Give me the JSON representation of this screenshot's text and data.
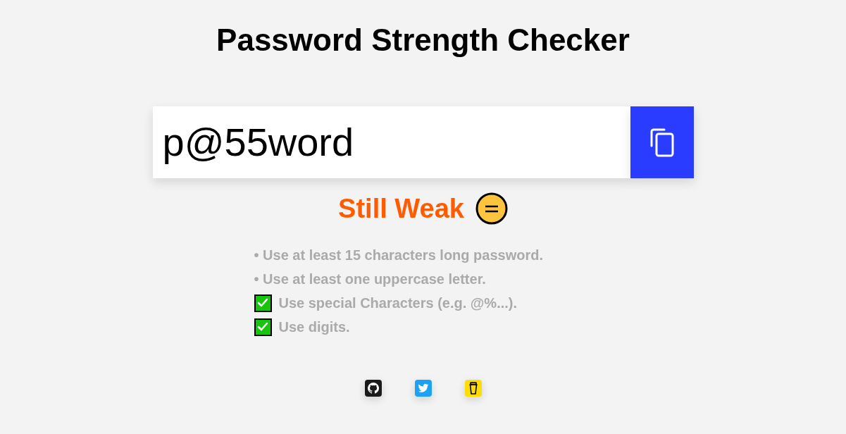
{
  "title": "Password Strength Checker",
  "password": {
    "value": "p@55word"
  },
  "strength": {
    "label": "Still Weak",
    "color": "#ff5b00"
  },
  "rules": {
    "bullet": "•",
    "items": [
      {
        "text": "Use at least 15 characters long password.",
        "met": false
      },
      {
        "text": "Use at least one uppercase letter.",
        "met": false
      },
      {
        "text": "Use special Characters (e.g. @%...).",
        "met": true
      },
      {
        "text": "Use digits.",
        "met": true
      }
    ]
  },
  "social_links": [
    {
      "kind": "github"
    },
    {
      "kind": "twitter"
    },
    {
      "kind": "coffee"
    }
  ]
}
